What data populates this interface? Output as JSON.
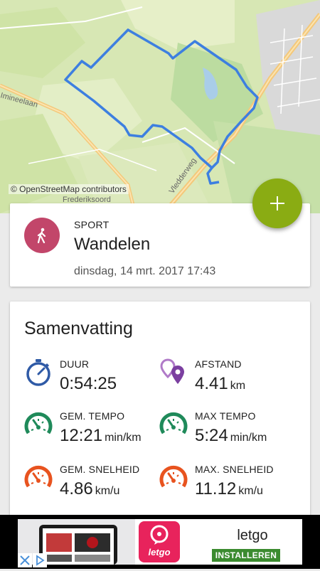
{
  "map": {
    "attribution": "© OpenStreetMap contributors",
    "street_labels": [
      "Imineelaan",
      "Vledderweg",
      "Frederiksoord"
    ]
  },
  "fab": {
    "icon": "plus-icon"
  },
  "sport_card": {
    "label": "SPORT",
    "name": "Wandelen",
    "date": "dinsdag, 14 mrt. 2017 17:43",
    "avatar_color": "#c2466a",
    "icon": "walking-person-icon"
  },
  "summary": {
    "title": "Samenvatting",
    "stats": {
      "duration": {
        "label": "DUUR",
        "value": "0:54:25",
        "unit": "",
        "icon": "stopwatch-icon",
        "color": "#2f5aa6"
      },
      "distance": {
        "label": "AFSTAND",
        "value": "4.41",
        "unit": "km",
        "icon": "map-pins-icon",
        "color": "#7b3fa0"
      },
      "avg_pace": {
        "label": "GEM. TEMPO",
        "value": "12:21",
        "unit": "min/km",
        "icon": "gauge-icon",
        "color": "#1f8a5a"
      },
      "max_pace": {
        "label": "MAX TEMPO",
        "value": "5:24",
        "unit": "min/km",
        "icon": "gauge-icon",
        "color": "#1f8a5a"
      },
      "avg_speed": {
        "label": "GEM. SNELHEID",
        "value": "4.86",
        "unit": "km/u",
        "icon": "gauge-icon",
        "color": "#e8531f"
      },
      "max_speed": {
        "label": "MAX. SNELHEID",
        "value": "11.12",
        "unit": "km/u",
        "icon": "gauge-icon",
        "color": "#e8531f"
      }
    }
  },
  "ad": {
    "logo_text": "letgo",
    "brand": "letgo",
    "install_label": "INSTALLEREN"
  },
  "colors": {
    "accent": "#8aac13",
    "route": "#3d7fe0"
  }
}
